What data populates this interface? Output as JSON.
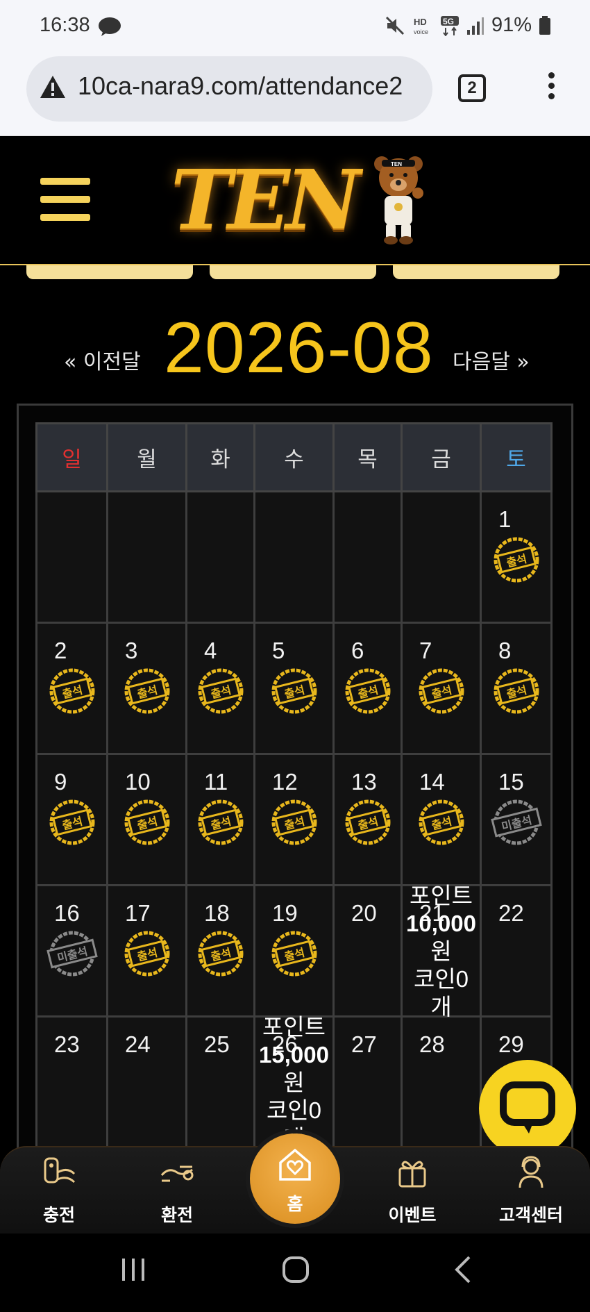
{
  "status_bar": {
    "time": "16:38",
    "battery": "91%"
  },
  "browser": {
    "url": "10ca-nara9.com/attendance2",
    "tab_count": "2"
  },
  "site": {
    "logo_text": "TEN"
  },
  "calendar": {
    "prev_label": "« 이전달",
    "next_label": "다음달 »",
    "month": "2026-08",
    "weekdays": [
      "일",
      "월",
      "화",
      "수",
      "목",
      "금",
      "토"
    ],
    "stamp_present": "출석",
    "stamp_absent": "미출석",
    "weeks": [
      [
        {
          "day": ""
        },
        {
          "day": ""
        },
        {
          "day": ""
        },
        {
          "day": ""
        },
        {
          "day": ""
        },
        {
          "day": ""
        },
        {
          "day": "1",
          "status": "present"
        }
      ],
      [
        {
          "day": "2",
          "status": "present"
        },
        {
          "day": "3",
          "status": "present"
        },
        {
          "day": "4",
          "status": "present"
        },
        {
          "day": "5",
          "status": "present"
        },
        {
          "day": "6",
          "status": "present"
        },
        {
          "day": "7",
          "status": "present"
        },
        {
          "day": "8",
          "status": "present"
        }
      ],
      [
        {
          "day": "9",
          "status": "present"
        },
        {
          "day": "10",
          "status": "present"
        },
        {
          "day": "11",
          "status": "present"
        },
        {
          "day": "12",
          "status": "present"
        },
        {
          "day": "13",
          "status": "present"
        },
        {
          "day": "14",
          "status": "present"
        },
        {
          "day": "15",
          "status": "absent"
        }
      ],
      [
        {
          "day": "16",
          "status": "absent"
        },
        {
          "day": "17",
          "status": "present"
        },
        {
          "day": "18",
          "status": "present"
        },
        {
          "day": "19",
          "status": "present"
        },
        {
          "day": "20"
        },
        {
          "day": "21",
          "reward": {
            "line1": "포인트",
            "amount": "10,000",
            "line3": "원",
            "line4": "코인0",
            "line5": "개"
          }
        },
        {
          "day": "22"
        }
      ],
      [
        {
          "day": "23"
        },
        {
          "day": "24"
        },
        {
          "day": "25"
        },
        {
          "day": "26",
          "reward": {
            "line1": "포인트",
            "amount": "15,000",
            "line3": "원",
            "line4": "코인0",
            "line5": "개"
          }
        },
        {
          "day": "27"
        },
        {
          "day": "28"
        },
        {
          "day": "29"
        }
      ]
    ]
  },
  "bottom_nav": {
    "deposit": "충전",
    "withdraw": "환전",
    "home": "홈",
    "event": "이벤트",
    "support": "고객센터"
  },
  "colors": {
    "accent": "#f6c51c",
    "sunday": "#e23030",
    "saturday": "#4fa8e8",
    "home": "#e39a2a"
  }
}
